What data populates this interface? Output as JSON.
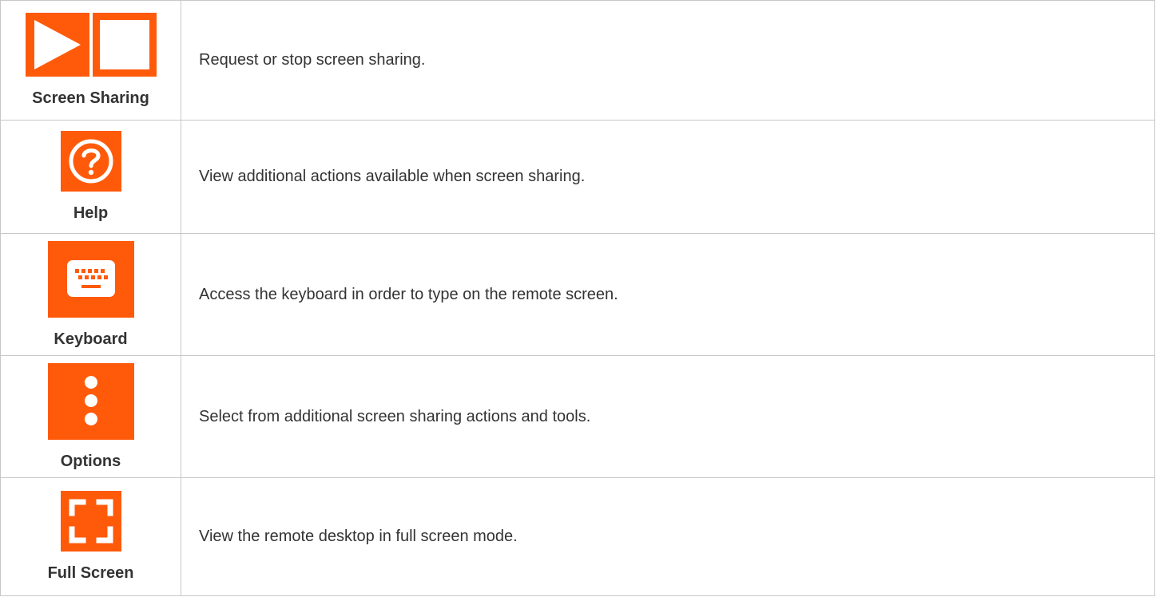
{
  "colors": {
    "accent": "#ff5a0a",
    "text": "#333333",
    "border": "#c8c8c8"
  },
  "rows": [
    {
      "label": "Screen Sharing",
      "description": "Request or stop screen sharing.",
      "icons": [
        "play-icon",
        "stop-icon"
      ]
    },
    {
      "label": "Help",
      "description": "View additional actions available when screen sharing.",
      "icons": [
        "help-icon"
      ]
    },
    {
      "label": "Keyboard",
      "description": "Access the keyboard in order to type on the remote screen.",
      "icons": [
        "keyboard-icon"
      ]
    },
    {
      "label": "Options",
      "description": "Select from additional screen sharing actions and tools.",
      "icons": [
        "more-vertical-icon"
      ]
    },
    {
      "label": "Full Screen",
      "description": "View the remote desktop in full screen mode.",
      "icons": [
        "fullscreen-icon"
      ]
    }
  ]
}
